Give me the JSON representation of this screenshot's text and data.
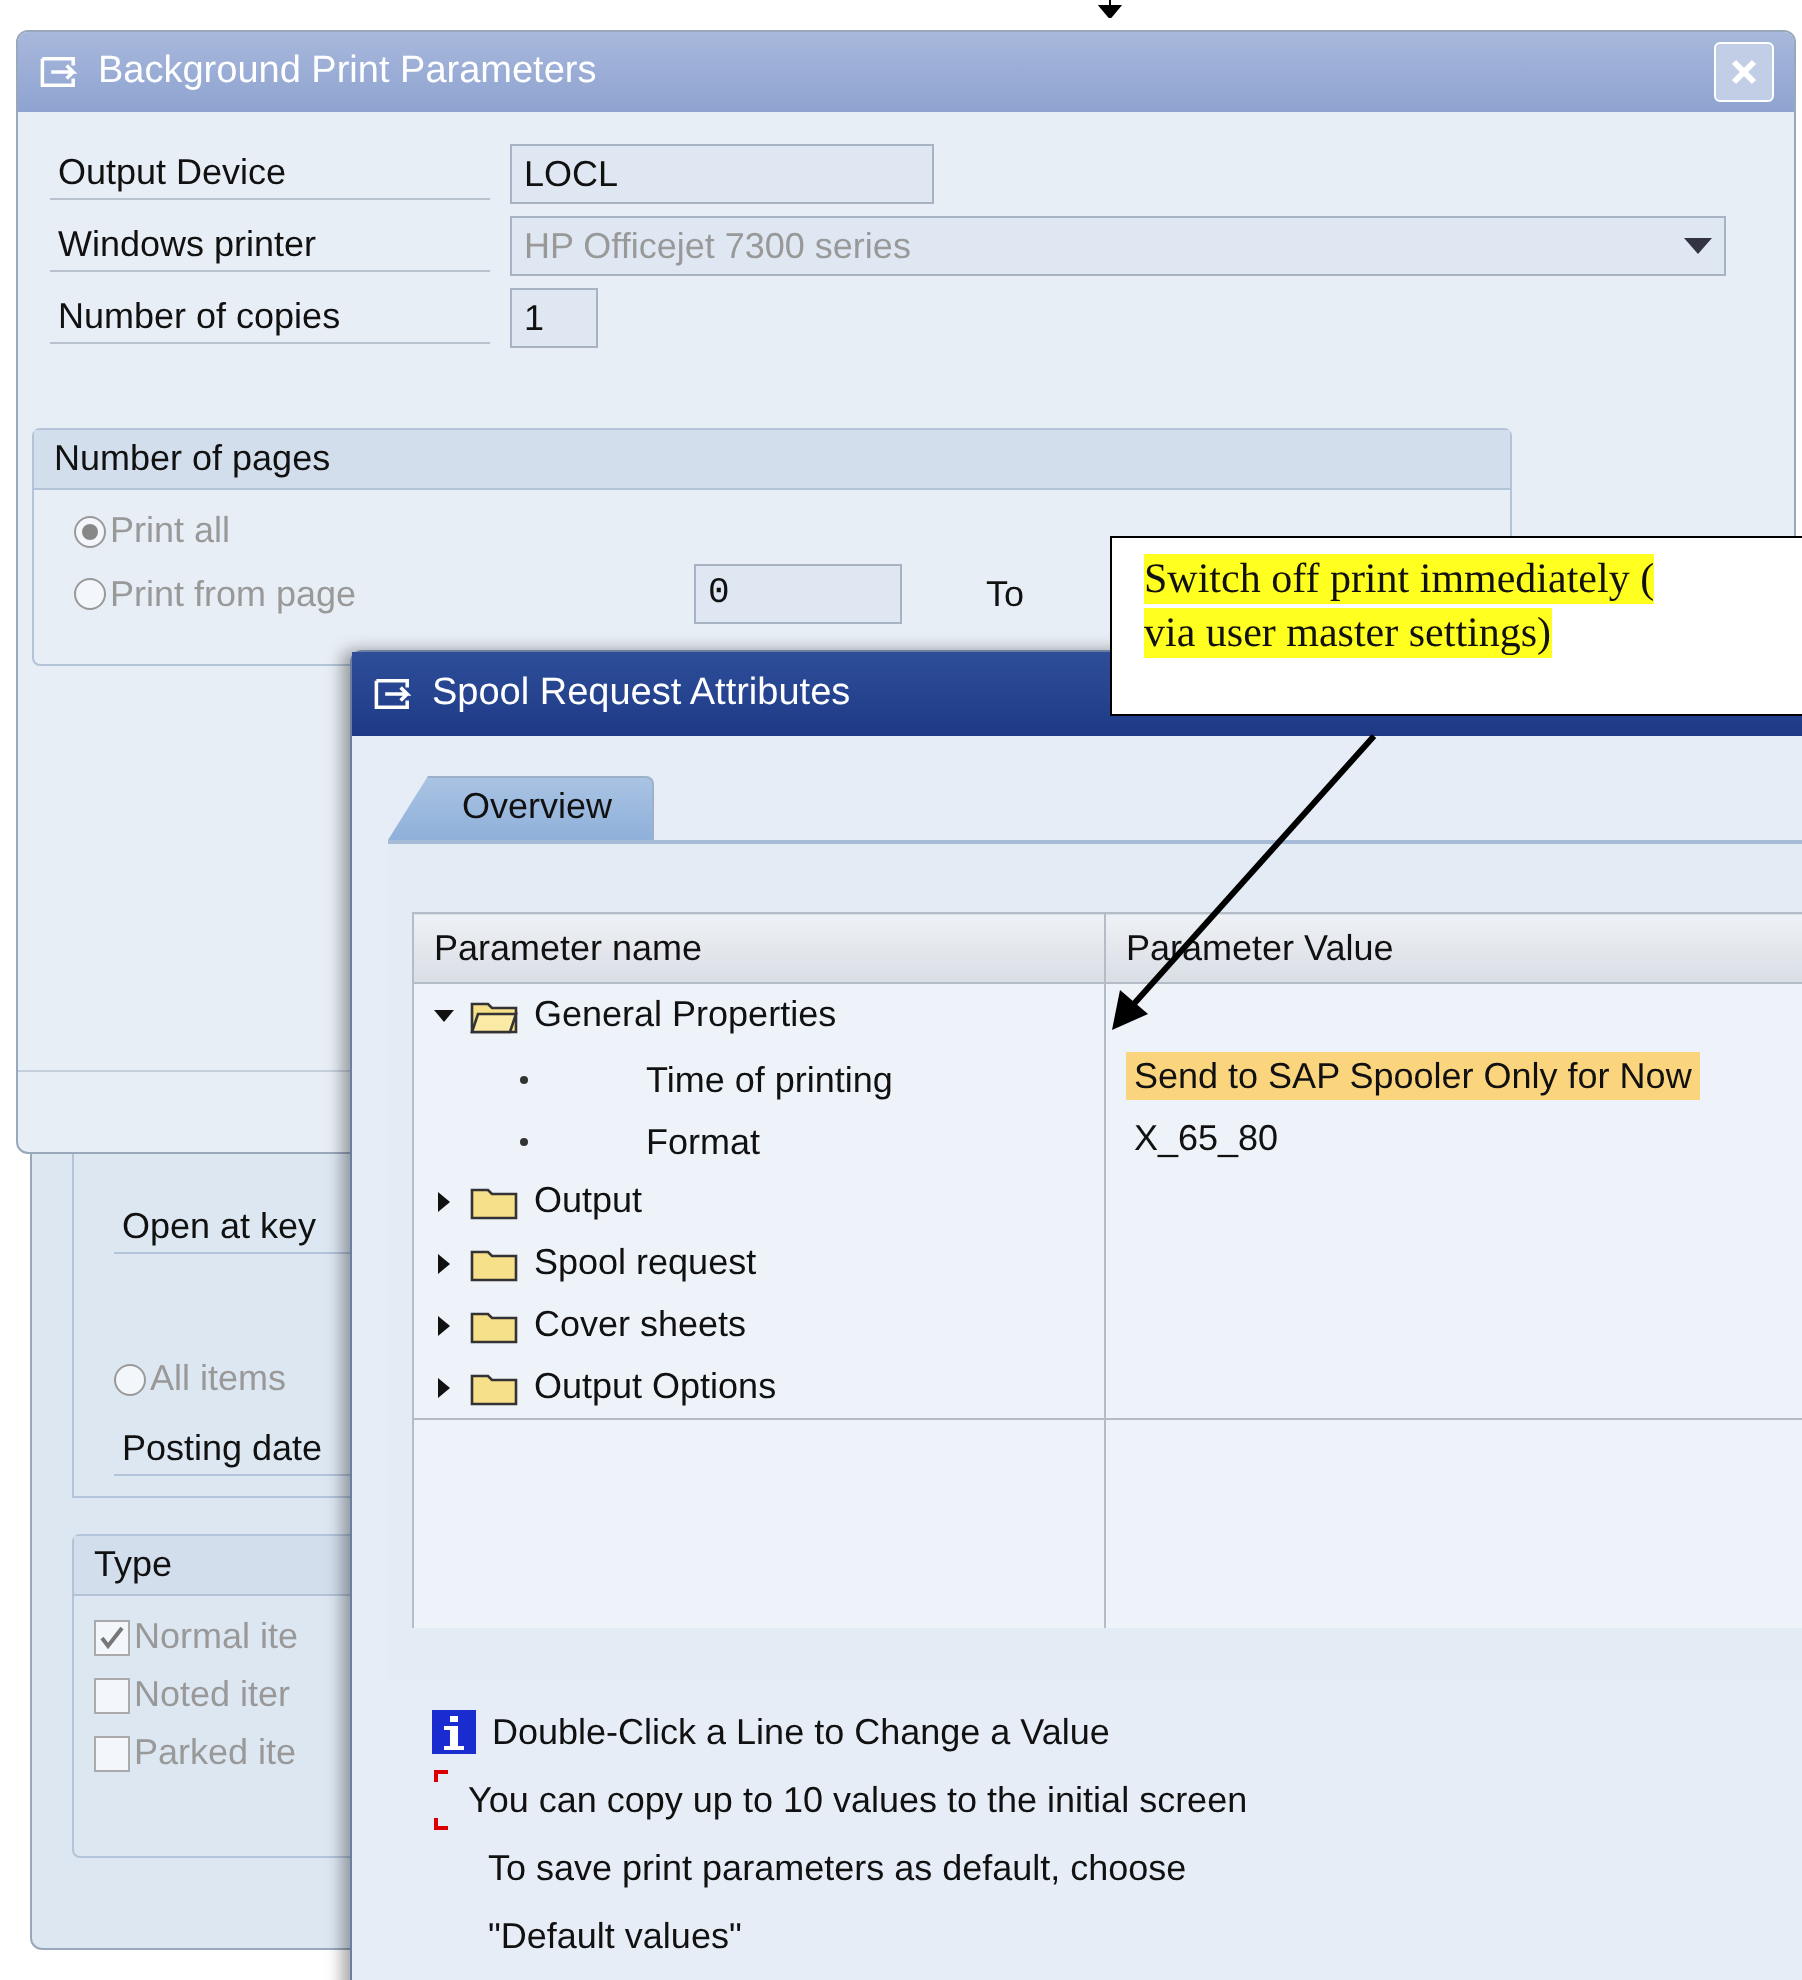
{
  "print_window": {
    "title": "Background Print Parameters",
    "fields": [
      {
        "label": "Output Device",
        "value": "LOCL",
        "kind": "text",
        "disabled": false
      },
      {
        "label": "Windows printer",
        "value": "HP Officejet 7300 series",
        "kind": "dropdown",
        "disabled": true
      },
      {
        "label": "Number of copies",
        "value": "1",
        "kind": "short",
        "disabled": false
      }
    ],
    "pages_group": {
      "title": "Number of pages",
      "disabled": true,
      "options": [
        {
          "label": "Print all",
          "selected": true
        },
        {
          "label": "Print from page",
          "selected": false
        }
      ],
      "from_value": "0",
      "to_label": "To"
    }
  },
  "behind_window": {
    "key_label": "Open at key",
    "radio": {
      "label": "All items",
      "selected": false
    },
    "posting_label": "Posting date",
    "type_group": {
      "title": "Type",
      "disabled": true,
      "items": [
        {
          "label": "Normal ite",
          "checked": true
        },
        {
          "label": "Noted iter",
          "checked": false
        },
        {
          "label": "Parked ite",
          "checked": false
        }
      ]
    }
  },
  "spool_window": {
    "title": "Spool Request Attributes",
    "tabs": [
      {
        "label": "Overview",
        "selected": true
      }
    ],
    "table": {
      "columns": [
        "Parameter name",
        "Parameter Value"
      ],
      "rows": [
        {
          "name": "General Properties",
          "expanded": true,
          "children": [
            {
              "name": "Time of printing",
              "value": "Send to SAP Spooler Only for Now",
              "highlighted": true
            },
            {
              "name": "Format",
              "value": "X_65_80",
              "highlighted": false
            }
          ]
        },
        {
          "name": "Output",
          "expanded": false
        },
        {
          "name": "Spool request",
          "expanded": false
        },
        {
          "name": "Cover sheets",
          "expanded": false
        },
        {
          "name": "Output Options",
          "expanded": false
        }
      ]
    },
    "messages": [
      {
        "kind": "info",
        "text": "Double-Click a Line to Change a Value"
      },
      {
        "kind": "copy",
        "text": "You can copy up to 10 values to the initial screen"
      },
      {
        "kind": "plain",
        "text": "To save print parameters as default, choose"
      },
      {
        "kind": "plain",
        "text": "\"Default values\""
      }
    ]
  },
  "callout": {
    "lines": [
      "Switch off print immediately (",
      "via user master settings)"
    ]
  }
}
